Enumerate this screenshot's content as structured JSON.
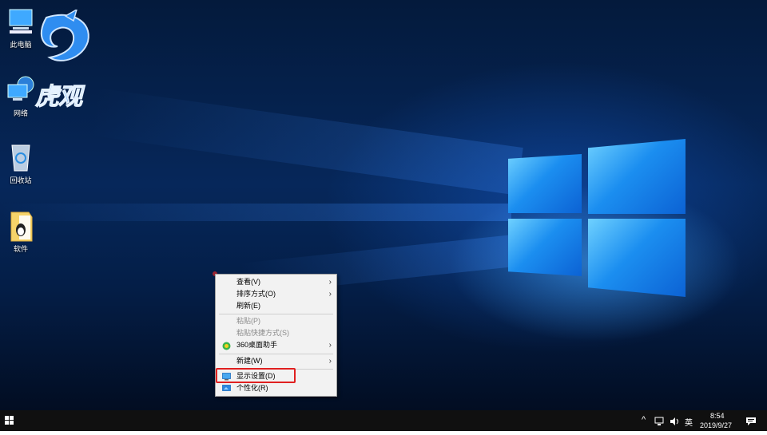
{
  "desktop": {
    "icons": [
      {
        "label": "此电脑",
        "icon": "computer-icon"
      },
      {
        "label": "网络",
        "icon": "network-icon"
      },
      {
        "label": "回收站",
        "icon": "recycle-bin-icon"
      },
      {
        "label": "软件",
        "icon": "folder-icon"
      }
    ],
    "watermark_text": "虎观"
  },
  "context_menu": {
    "items": [
      {
        "label": "查看(V)",
        "submenu": true
      },
      {
        "label": "排序方式(O)",
        "submenu": true
      },
      {
        "label": "刷新(E)"
      },
      {
        "label": "粘贴(P)",
        "disabled": true
      },
      {
        "label": "粘贴快捷方式(S)",
        "disabled": true
      },
      {
        "label": "360桌面助手",
        "icon": "360-icon",
        "submenu": true
      },
      {
        "label": "新建(W)",
        "submenu": true
      },
      {
        "label": "显示设置(D)",
        "icon": "display-settings-icon",
        "highlighted": true
      },
      {
        "label": "个性化(R)",
        "icon": "personalize-icon"
      }
    ]
  },
  "taskbar": {
    "start_icon": "windows-start-icon",
    "tray": {
      "chevron_icon": "chevron-up-icon",
      "network_icon": "network-tray-icon",
      "volume_icon": "volume-icon",
      "ime": "英",
      "time": "8:54",
      "date": "2019/9/27",
      "notification_icon": "action-center-icon"
    }
  },
  "colors": {
    "highlight_border": "#e02020",
    "taskbar": "#101010",
    "accent": "#1b8ef0"
  }
}
